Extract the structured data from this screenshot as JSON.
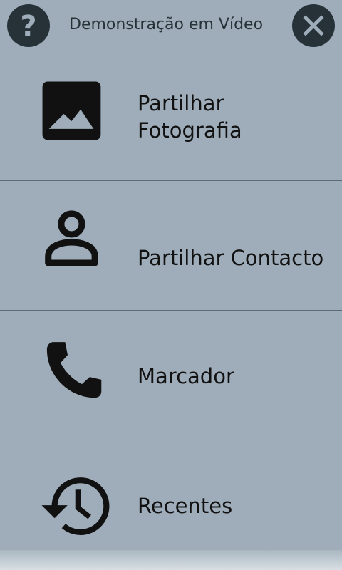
{
  "header": {
    "title": "Demonstração em Vídeo",
    "help_icon": "question-mark-icon",
    "close_icon": "close-icon"
  },
  "menu": {
    "items": [
      {
        "label": "Partilhar\nFotografia",
        "icon": "photo-icon"
      },
      {
        "label": "Partilhar Contacto",
        "icon": "contact-person-icon"
      },
      {
        "label": "Marcador",
        "icon": "phone-icon"
      },
      {
        "label": "Recentes",
        "icon": "history-icon"
      }
    ]
  },
  "colors": {
    "background": "#9eadb9",
    "header_button": "#263238",
    "divider": "#5f6b74",
    "text": "#111111"
  }
}
